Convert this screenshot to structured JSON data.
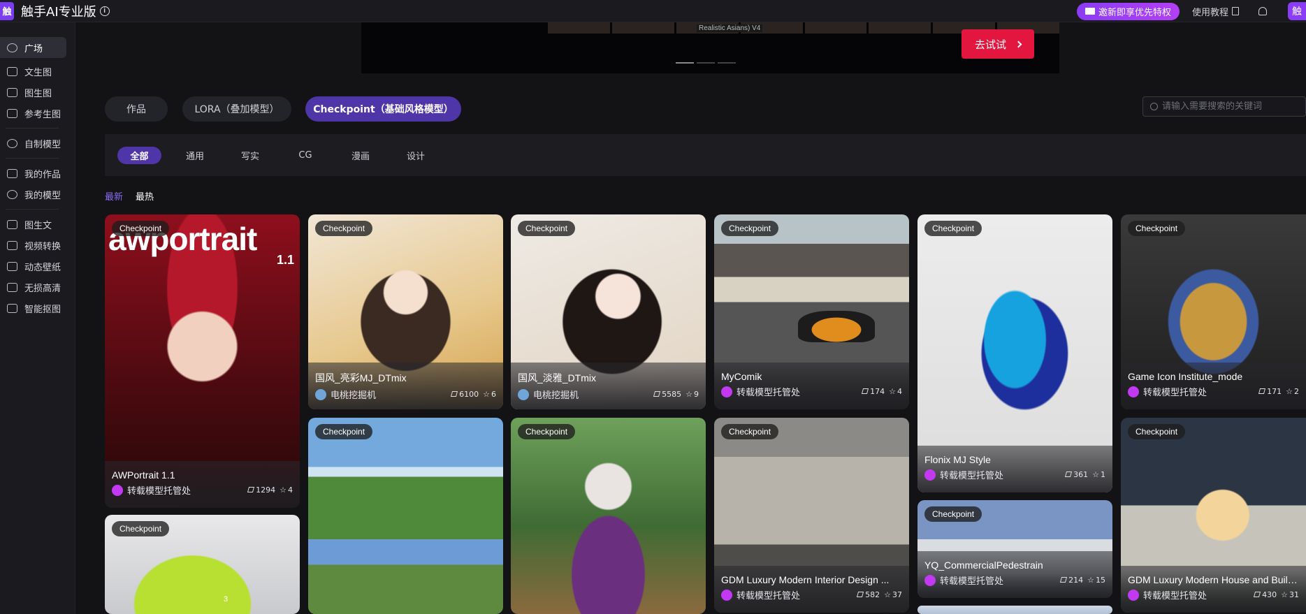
{
  "app": {
    "logo_char": "触",
    "title": "触手AI专业版",
    "info_glyph": "i",
    "invite_label": "邀新即享优先特权",
    "guide_label": "使用教程",
    "avatar_char": "触"
  },
  "sidebar": {
    "items": [
      {
        "label": "广场",
        "icon": "planet-icon",
        "active": true
      },
      {
        "label": "文生图",
        "icon": "image-text-icon"
      },
      {
        "label": "图生图",
        "icon": "image-image-icon"
      },
      {
        "label": "参考生图",
        "icon": "reference-image-icon"
      },
      {
        "label": "自制模型",
        "icon": "custom-model-icon"
      },
      {
        "label": "我的作品",
        "icon": "my-works-icon"
      },
      {
        "label": "我的模型",
        "icon": "my-models-icon"
      },
      {
        "label": "图生文",
        "icon": "image-to-text-icon"
      },
      {
        "label": "视频转换",
        "icon": "video-convert-icon"
      },
      {
        "label": "动态壁纸",
        "icon": "live-wallpaper-icon"
      },
      {
        "label": "无损高清",
        "icon": "hd-upscale-icon"
      },
      {
        "label": "智能抠图",
        "icon": "smart-cutout-icon"
      }
    ]
  },
  "banner": {
    "caption": "Realistic Asians) V4",
    "cta_label": "去试试"
  },
  "tabs": [
    {
      "label": "作品",
      "active": false
    },
    {
      "label": "LORA（叠加模型）",
      "active": false
    },
    {
      "label": "Checkpoint（基础风格模型）",
      "active": true
    }
  ],
  "search": {
    "placeholder": "请输入需要搜索的关键词"
  },
  "filters": [
    "全部",
    "通用",
    "写实",
    "CG",
    "漫画",
    "设计"
  ],
  "sort": {
    "newest": "最新",
    "hottest": "最热"
  },
  "badge_label": "Checkpoint",
  "cards": [
    {
      "title": "AWPortrait 1.1",
      "author": "转载模型托管处",
      "uses": "1294",
      "stars": "4",
      "overlay_text": "awportrait",
      "overlay_version": "1.1"
    },
    {
      "title": "国风_亮彩MJ_DTmix",
      "author": "电桃挖掘机",
      "uses": "6100",
      "stars": "6"
    },
    {
      "title": "国风_淡雅_DTmix",
      "author": "电桃挖掘机",
      "uses": "5585",
      "stars": "9"
    },
    {
      "title": "MyComik",
      "author": "转载模型托管处",
      "uses": "174",
      "stars": "4"
    },
    {
      "title": "Flonix MJ Style",
      "author": "转载模型托管处",
      "uses": "361",
      "stars": "1"
    },
    {
      "title": "Game Icon Institute_mode",
      "author": "转载模型托管处",
      "uses": "171",
      "stars": "2"
    },
    {
      "title": "GDM Luxury Modern Interior Design ...",
      "author": "转载模型托管处",
      "uses": "582",
      "stars": "37"
    },
    {
      "title": "YQ_CommercialPedestrain",
      "author": "转载模型托管处",
      "uses": "214",
      "stars": "15"
    },
    {
      "title": "GDM Luxury Modern House and Build...",
      "author": "转载模型托管处",
      "uses": "430",
      "stars": "31"
    }
  ],
  "misc": {
    "bus_number": "3"
  }
}
